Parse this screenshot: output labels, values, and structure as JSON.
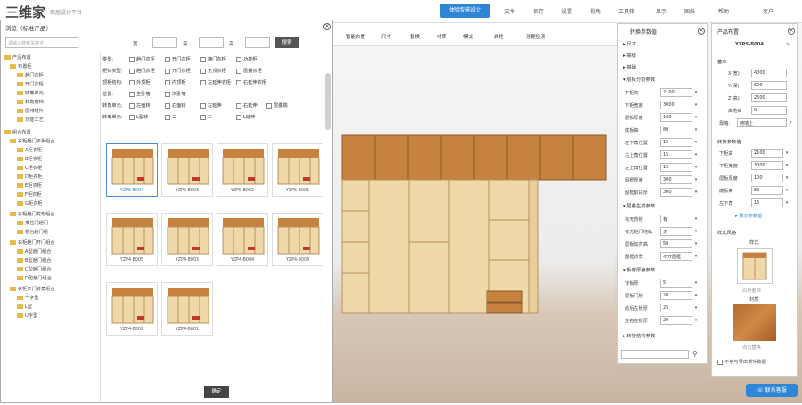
{
  "app": {
    "logo": "三维家",
    "subtitle": "家居设计平台",
    "top_button": "体验智能设计",
    "menu": [
      "文件",
      "保存",
      "设置",
      "视角",
      "工具箱",
      "显示",
      "图纸",
      "帮助",
      "客户"
    ]
  },
  "toolbar": {
    "items": [
      "智能布置",
      "尺寸",
      "替换",
      "材质",
      "模式",
      "吊柜",
      "测距检测"
    ]
  },
  "dialog": {
    "title": "浏览（标准产品）",
    "search_placeholder": "请输入搜索关键字",
    "width_label": "宽",
    "depth_label": "深",
    "height_label": "高",
    "search_button": "搜索",
    "ok_button": "确定",
    "tree": [
      "产品布置",
      "布置柜",
      "趟门衣柜",
      "开门衣柜",
      "转角单元",
      "转角搭档",
      "层排组件",
      "功能工艺",
      "组合布置",
      "衣柜趟门平板组合",
      "A柜衣柜",
      "B柜衣柜",
      "C柜衣柜",
      "D柜衣柜",
      "E柜衣柜",
      "F柜衣柜",
      "G柜衣柜",
      "衣柜趟门变形组合",
      "推拉门趟门",
      "窗台趟门组",
      "衣柜趟门开门组合",
      "A型趟门组合",
      "B型趟门组合",
      "C型趟门组合",
      "D型趟门组合",
      "衣柜开门转角组合",
      "一字型",
      "L型",
      "U字型"
    ],
    "filters": [
      {
        "label": "类型:",
        "options": [
          "趟门衣柜",
          "开门衣柜",
          "掩门衣柜",
          "功能柜"
        ]
      },
      {
        "label": "柜体类型:",
        "options": [
          "趟门衣柜",
          "开门衣柜",
          "无顶衣柜",
          "层叠衣柜"
        ]
      },
      {
        "label": "顶柜结构:",
        "options": [
          "外顶柜",
          "内顶柜",
          "左延伸衣柜",
          "右延伸衣柜"
        ]
      },
      {
        "label": "位置:",
        "options": [
          "主卧墙",
          "次卧墙"
        ]
      },
      {
        "label": "转角单元:",
        "options": [
          "左面转",
          "右面转",
          "左延伸",
          "右延伸",
          "层叠端"
        ]
      },
      {
        "label": "转角单元:",
        "options": [
          "L型转",
          "二",
          "三",
          "L延伸"
        ]
      }
    ],
    "products": [
      {
        "name": "YZPS-B004"
      },
      {
        "name": "YZPS-B003"
      },
      {
        "name": "YZPS-B002"
      },
      {
        "name": "YZPS-B001"
      },
      {
        "name": "YZP4-B005"
      },
      {
        "name": "YZP4-B003"
      },
      {
        "name": "YZP4-B004"
      },
      {
        "name": "YZP4-B003"
      },
      {
        "name": "YZP4-B002"
      },
      {
        "name": "YZP4-B001"
      }
    ]
  },
  "params_panel": {
    "title": "转换参数值",
    "sections": [
      "尺寸",
      "高级",
      "基础",
      "层板分割参数",
      "层叠生成参数",
      "板材厚度参数",
      "转接结构参数"
    ],
    "fields": [
      {
        "label": "下柜高",
        "value": "2100"
      },
      {
        "label": "下柜宽度",
        "value": "3000"
      },
      {
        "label": "层板厚度",
        "value": "100"
      },
      {
        "label": "底板高",
        "value": "80"
      },
      {
        "label": "左下角位置",
        "value": "15"
      },
      {
        "label": "右上角位置",
        "value": "15"
      },
      {
        "label": "左上角位置",
        "value": "15"
      },
      {
        "label": "固框厚度",
        "value": "300"
      },
      {
        "label": "固框前段厚",
        "value": "300"
      },
      {
        "label": "有无背板",
        "value": "有"
      },
      {
        "label": "有无趟门地轨",
        "value": "无"
      },
      {
        "label": "层板加背高",
        "value": "50"
      },
      {
        "label": "固框背景",
        "value": "不开固框"
      },
      {
        "label": "背板厚",
        "value": "5"
      },
      {
        "label": "层板门板",
        "value": "20"
      },
      {
        "label": "前后左板厚",
        "value": "25"
      },
      {
        "label": "左右左板厚",
        "value": "20"
      }
    ]
  },
  "product_panel": {
    "title": "产品布置",
    "product_name": "YZPS-B004",
    "basic_label": "基本",
    "fields": [
      {
        "label": "X(宽)",
        "value": "4000"
      },
      {
        "label": "Y(深)",
        "value": "600"
      },
      {
        "label": "Z(高)",
        "value": "2500"
      },
      {
        "label": "离地高",
        "value": "0"
      }
    ],
    "mode_label": "靠墙:",
    "mode_value": "两墙上",
    "cabinet_section": "转换参数值",
    "cabinet_fields": [
      {
        "label": "下柜高",
        "value": "2100"
      },
      {
        "label": "下柜宽度",
        "value": "3000"
      },
      {
        "label": "层板厚度",
        "value": "100"
      },
      {
        "label": "底板高",
        "value": "80"
      },
      {
        "label": "左下角",
        "value": "15"
      }
    ],
    "more_link": "▸ 展示参数值",
    "style_section": "样式风格",
    "style_label": "样式",
    "style_caption": "白色者书",
    "material_label": "材质",
    "material_caption": "点击替换",
    "checkbox_label": "不参与导出板件数据",
    "help_button": "联系客服"
  }
}
